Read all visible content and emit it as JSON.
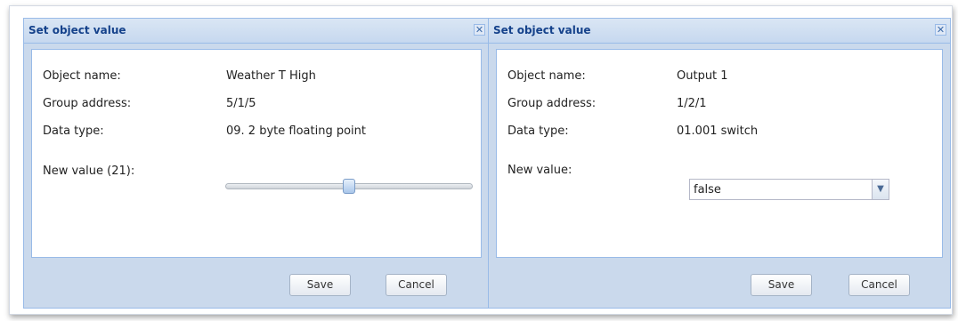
{
  "dialogs": [
    {
      "title": "Set object value",
      "close_glyph": "✕",
      "fields": [
        {
          "label": "Object name:",
          "value": "Weather T High"
        },
        {
          "label": "Group address:",
          "value": "5/1/5"
        },
        {
          "label": "Data type:",
          "value": "09. 2 byte floating point"
        }
      ],
      "new_value_label": "New value (21):",
      "slider_level_fraction": 0.49,
      "save_label": "Save",
      "cancel_label": "Cancel"
    },
    {
      "title": "Set object value",
      "close_glyph": "✕",
      "fields": [
        {
          "label": "Object name:",
          "value": "Output 1"
        },
        {
          "label": "Group address:",
          "value": "1/2/1"
        },
        {
          "label": "Data type:",
          "value": "01.001 switch"
        }
      ],
      "new_value_label": "New value:",
      "selected_value": "false",
      "dropdown_icon": "chevron-down-icon",
      "save_label": "Save",
      "cancel_label": "Cancel"
    }
  ],
  "colors": {
    "title_text": "#15428b",
    "dialog_bg": "#cad9ec",
    "border": "#99bbe8"
  }
}
